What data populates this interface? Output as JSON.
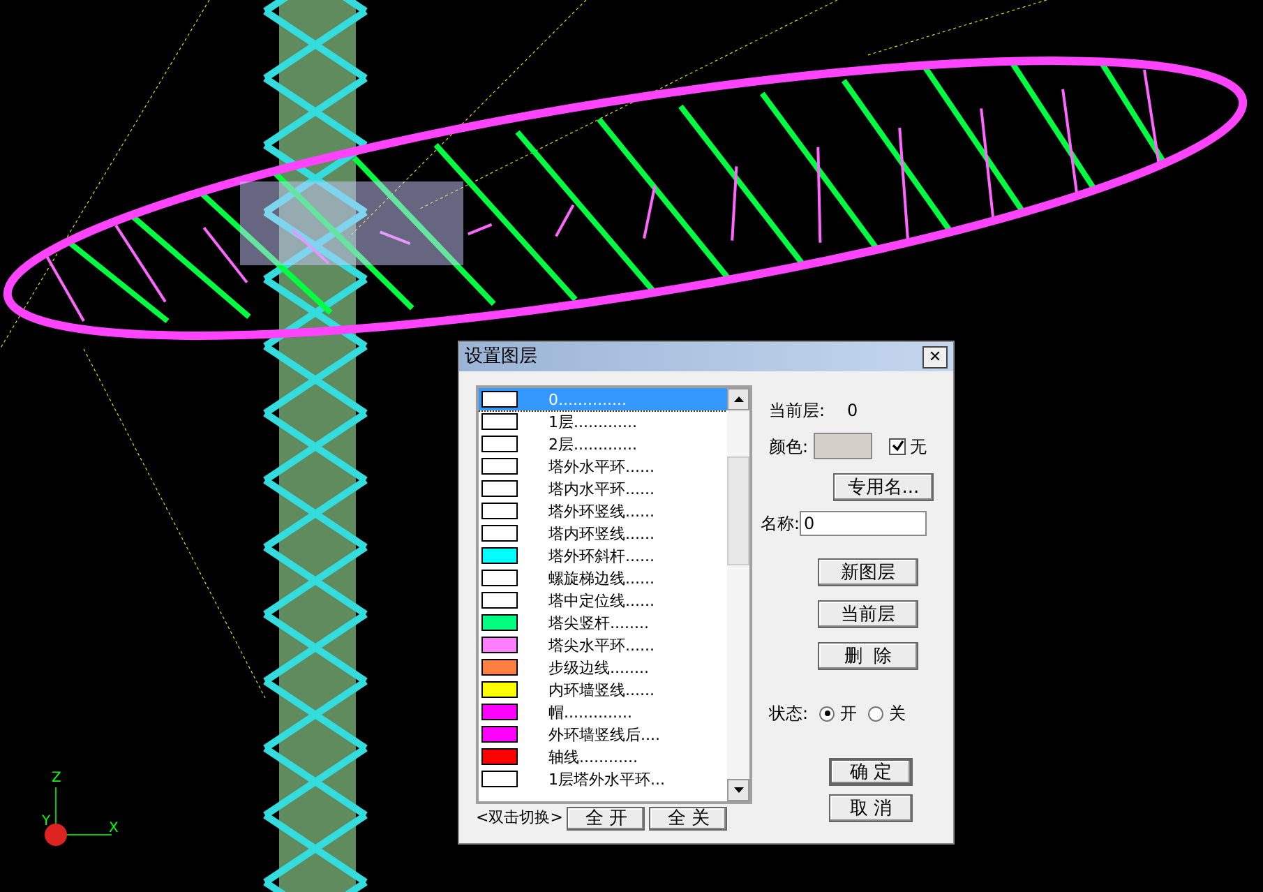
{
  "axes": {
    "z": "Z",
    "y": "Y",
    "x": "X"
  },
  "dialog": {
    "title": "设置图层",
    "close": "✕",
    "layers": [
      {
        "label": "0..............",
        "color": "#ffffff",
        "selected": true
      },
      {
        "label": "1层.............",
        "color": "#ffffff",
        "selected": false
      },
      {
        "label": "2层.............",
        "color": "#ffffff",
        "selected": false
      },
      {
        "label": "塔外水平环......",
        "color": "#ffffff",
        "selected": false
      },
      {
        "label": "塔内水平环......",
        "color": "#ffffff",
        "selected": false
      },
      {
        "label": "塔外环竖线......",
        "color": "#ffffff",
        "selected": false
      },
      {
        "label": "塔内环竖线......",
        "color": "#ffffff",
        "selected": false
      },
      {
        "label": "塔外环斜杆......",
        "color": "#00ffff",
        "selected": false
      },
      {
        "label": "螺旋梯边线......",
        "color": "#ffffff",
        "selected": false
      },
      {
        "label": "塔中定位线......",
        "color": "#ffffff",
        "selected": false
      },
      {
        "label": "塔尖竖杆........",
        "color": "#00ff80",
        "selected": false
      },
      {
        "label": "塔尖水平环......",
        "color": "#ff80ff",
        "selected": false
      },
      {
        "label": "步级边线........",
        "color": "#ff8040",
        "selected": false
      },
      {
        "label": "内环墙竖线......",
        "color": "#ffff00",
        "selected": false
      },
      {
        "label": "帽..............",
        "color": "#ff00ff",
        "selected": false
      },
      {
        "label": "外环墙竖线后....",
        "color": "#ff00ff",
        "selected": false
      },
      {
        "label": "轴线............",
        "color": "#ff0000",
        "selected": false
      },
      {
        "label": "1层塔外水平环...",
        "color": "#ffffff",
        "selected": false
      }
    ],
    "toggle_hint": "<双击切换>",
    "all_on": "全 开",
    "all_off": "全 关",
    "current_layer_label": "当前层:",
    "current_layer_value": "0",
    "color_label": "颜色:",
    "none_label": "无",
    "none_checked": true,
    "special_name_button": "专用名...",
    "name_label": "名称:",
    "name_value": "0",
    "buttons": [
      "新图层",
      "当前层",
      "删  除"
    ],
    "state_label": "状态:",
    "state_options": [
      {
        "label": "开",
        "selected": true
      },
      {
        "label": "关",
        "selected": false
      }
    ],
    "ok": "确 定",
    "cancel": "取 消"
  }
}
